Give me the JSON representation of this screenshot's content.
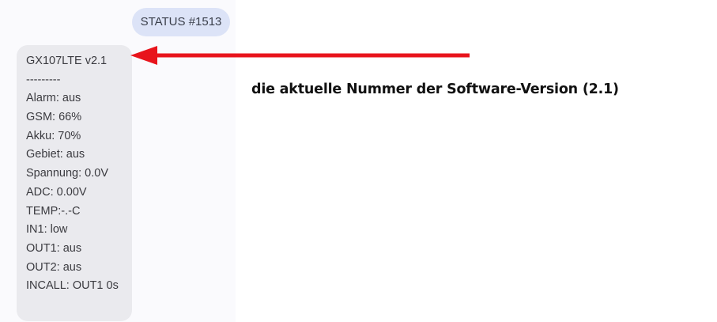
{
  "chat": {
    "sent_message": "STATUS #1513",
    "received_message": {
      "lines": [
        "GX107LTE v2.1",
        "---------",
        "Alarm: aus",
        "GSM: 66%",
        "Akku:  70%",
        "Gebiet: aus",
        "Spannung:  0.0V",
        "ADC: 0.00V",
        "TEMP:-.-C",
        "IN1: low",
        "OUT1: aus",
        "OUT2: aus",
        "INCALL: OUT1 0s"
      ]
    }
  },
  "annotation": {
    "text": "die aktuelle Nummer der Software-Version (2.1)",
    "arrow_color": "#e8141c"
  }
}
